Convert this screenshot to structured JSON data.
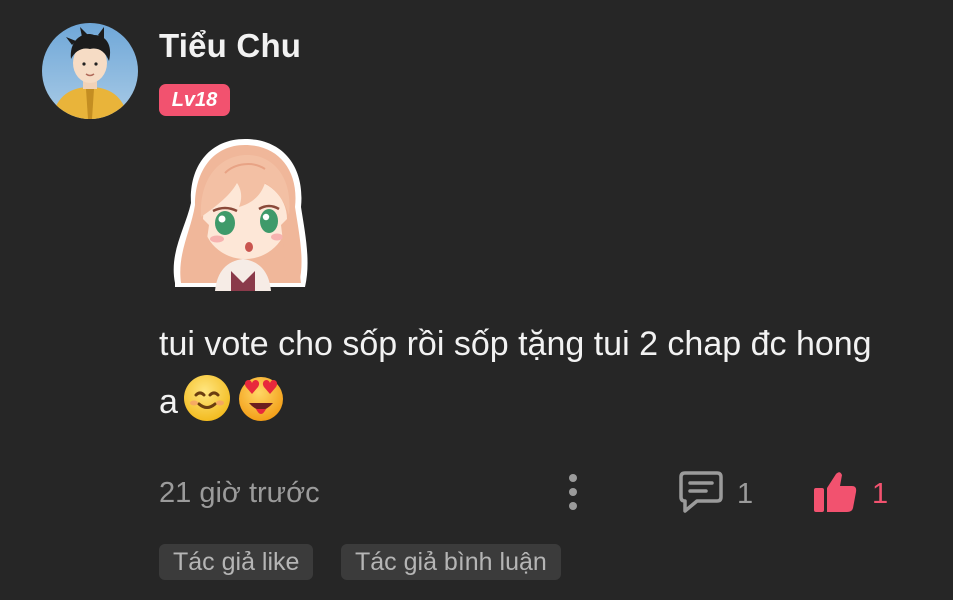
{
  "comment": {
    "username": "Tiểu Chu",
    "level": "Lv18",
    "text": "tui vote cho sốp rồi sốp tặng tui 2 chap đc hong a",
    "emojis": [
      "smiling-face-emoji",
      "heart-eyes-emoji"
    ],
    "timestamp": "21 giờ trước",
    "reply_count": "1",
    "like_count": "1",
    "tags": [
      "Tác giả like",
      "Tác giả bình luận"
    ]
  },
  "colors": {
    "background": "#262626",
    "accent": "#f2526f",
    "muted_text": "#9b9b9b",
    "tag_background": "#3b3b3b"
  },
  "icons": [
    "avatar",
    "anime-girl-sticker",
    "more-vertical-icon",
    "comment-icon",
    "thumbs-up-icon"
  ]
}
